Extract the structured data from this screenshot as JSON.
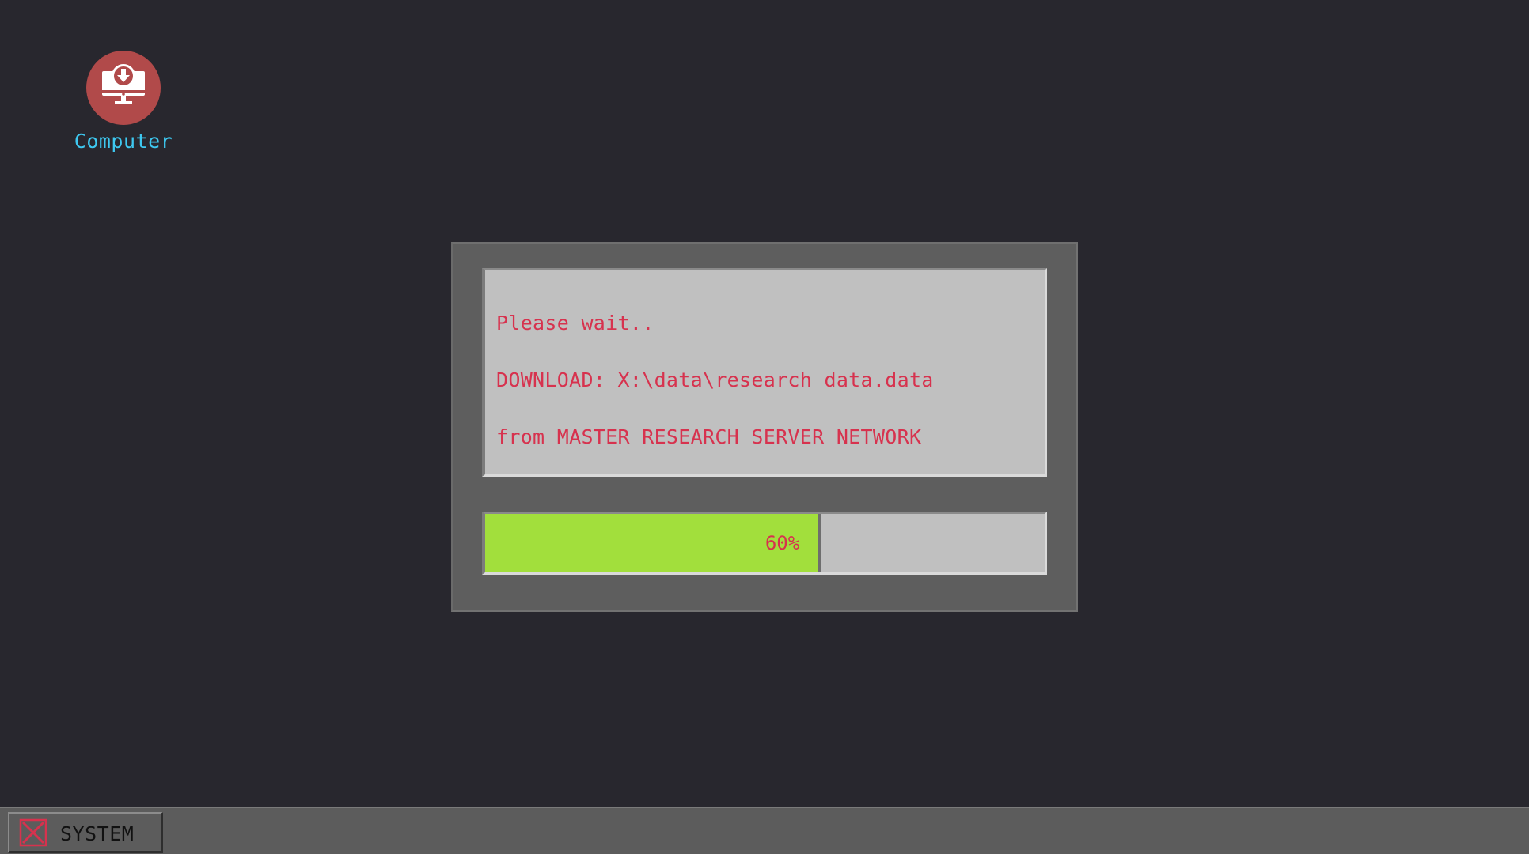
{
  "desktop": {
    "icon": {
      "name": "computer-download-icon",
      "label": "Computer",
      "color": "#b14a4a",
      "label_color": "#3ec8f0"
    }
  },
  "dialog": {
    "lines": [
      "Please wait..",
      "DOWNLOAD: X:\\data\\research_data.data",
      "from MASTER_RESEARCH_SERVER_NETWORK"
    ],
    "text_color": "#d7324e",
    "progress": {
      "fraction": 0.6,
      "label": "60%",
      "fill_color": "#a2df3c"
    }
  },
  "taskbar": {
    "start_label": "SYSTEM",
    "start_icon": "close-x-icon",
    "start_icon_color": "#d7324e"
  }
}
